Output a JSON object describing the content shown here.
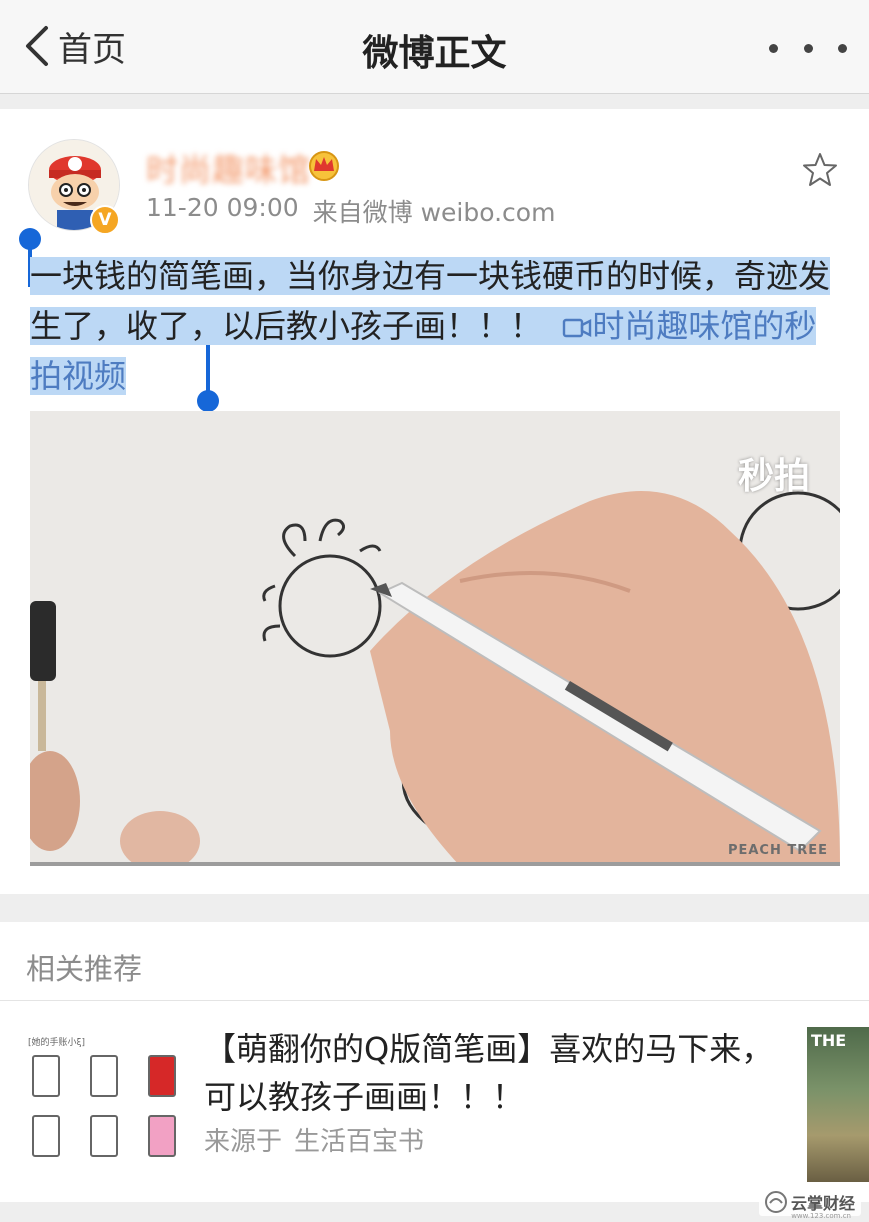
{
  "nav": {
    "back_label": "首页",
    "title": "微博正文"
  },
  "post": {
    "username": "时尚趣味馆",
    "verified_mark": "V",
    "time": "11-20 09:00",
    "source": "来自微博 weibo.com",
    "text_main": "一块钱的简笔画，当你身边有一块钱硬币的时候，奇迹发生了，收了，以后教小孩子画！！！",
    "video_link": "时尚趣味馆的秒拍视频",
    "selected": true
  },
  "video": {
    "watermark": "秒拍",
    "credit": "PEACH TREE"
  },
  "related": {
    "header": "相关推荐",
    "item": {
      "title": "【萌翻你的Q版简笔画】喜欢的马下来，可以教孩子画画！！！",
      "source_prefix": "来源于",
      "source_name": "生活百宝书",
      "thumb_header": "[她的手账小ξ]",
      "side_thumb_text": "THE"
    }
  },
  "watermark": {
    "name": "云掌财经",
    "url": "www.123.com.cn"
  },
  "colors": {
    "link": "#4e7cc1",
    "selection": "#bcd8f5",
    "handle": "#1667d8",
    "username": "#f39a6d",
    "meta": "#8c8c8c"
  }
}
